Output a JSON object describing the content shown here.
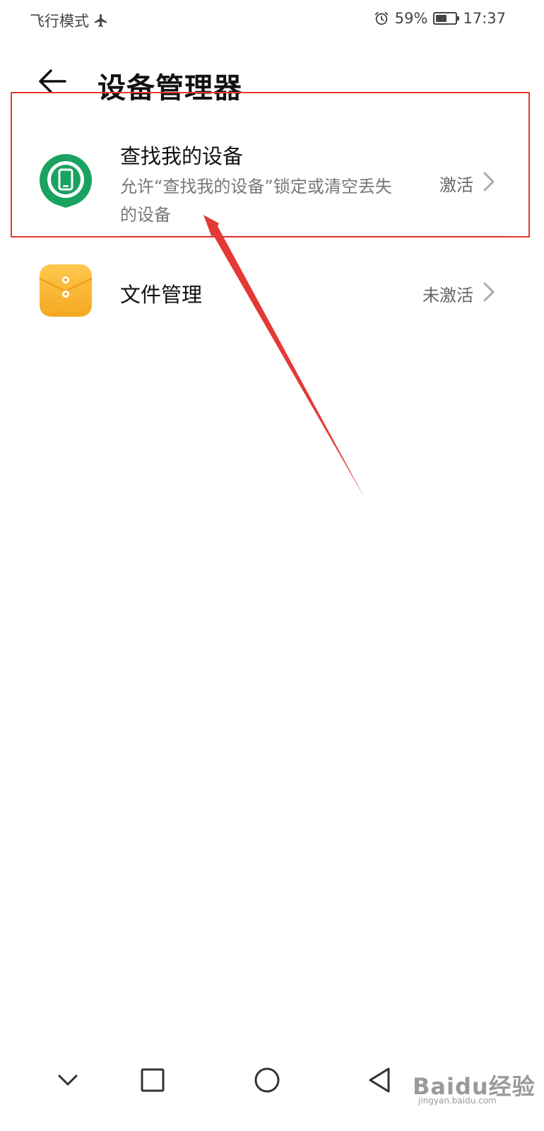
{
  "status_bar": {
    "mode_label": "飞行模式",
    "mode_icon": "airplane-icon",
    "alarm_icon": "alarm-icon",
    "battery_percent": "59%",
    "battery_level": 0.59,
    "time": "17:37"
  },
  "header": {
    "back_icon": "back-arrow-icon",
    "title": "设备管理器"
  },
  "items": [
    {
      "title": "查找我的设备",
      "subtitle": "允许“查找我的设备”锁定或清空丢失的设备",
      "status": "激活",
      "icon": "find-device-icon",
      "icon_color": "#1aa260"
    },
    {
      "title": "文件管理",
      "status": "未激活",
      "icon": "file-manager-icon",
      "icon_color": "#f5a623"
    }
  ],
  "annotation": {
    "highlight_color": "#e53935"
  },
  "nav_bar": {
    "collapse_icon": "chevron-down-icon",
    "recent_icon": "square-icon",
    "home_icon": "circle-icon",
    "back_icon": "triangle-back-icon"
  },
  "watermark": {
    "text": "Baidu经验",
    "url": "jingyan.baidu.com"
  }
}
